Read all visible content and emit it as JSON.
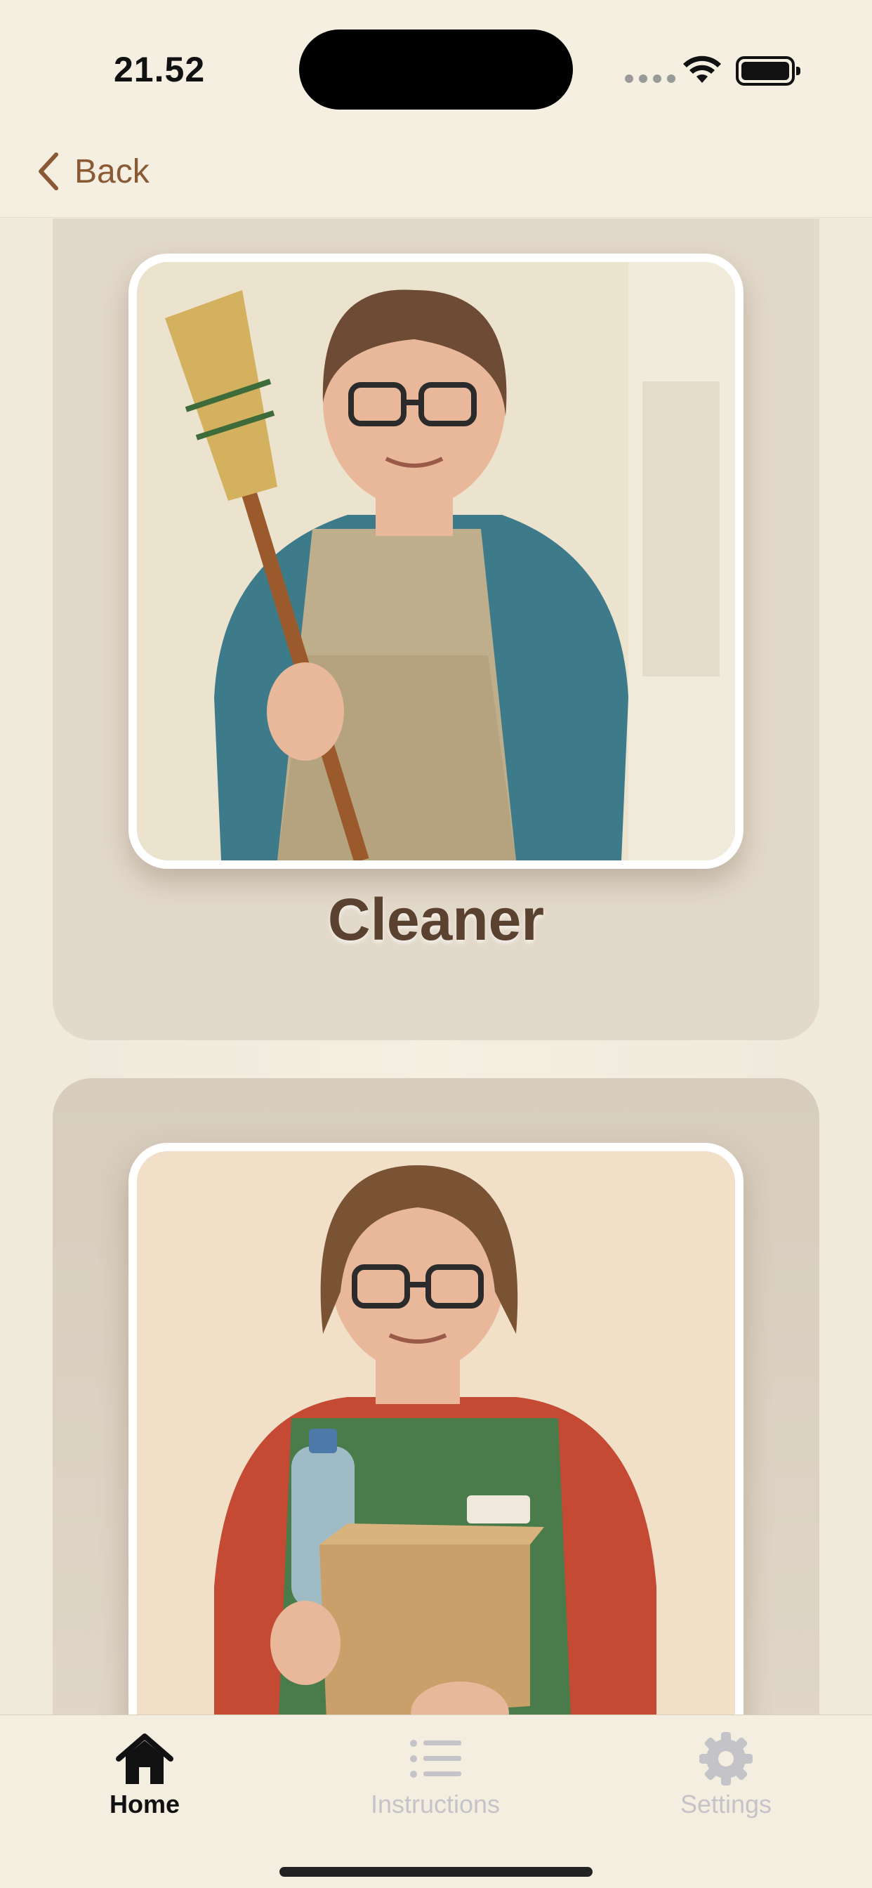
{
  "status_bar": {
    "time": "21.52",
    "signal_icon": "cellular-signal-icon",
    "wifi_icon": "wifi-icon",
    "battery_icon": "battery-icon"
  },
  "nav": {
    "back_label": "Back",
    "back_icon": "chevron-left-icon"
  },
  "cards": [
    {
      "title": "Cleaner",
      "image": "illustration of a person holding a broom"
    },
    {
      "title": "",
      "image": "illustration of a person holding a water bottle and a cardboard box"
    }
  ],
  "tabs": [
    {
      "label": "Home",
      "icon": "house-icon",
      "selected": true
    },
    {
      "label": "Instructions",
      "icon": "list-icon",
      "selected": false
    },
    {
      "label": "Settings",
      "icon": "gear-icon",
      "selected": false
    }
  ],
  "colors": {
    "background": "#f5efe2",
    "card": "#e3d9ca",
    "accent": "#8a5a35",
    "title": "#5a4130",
    "tab_inactive": "#c4c4c8"
  }
}
